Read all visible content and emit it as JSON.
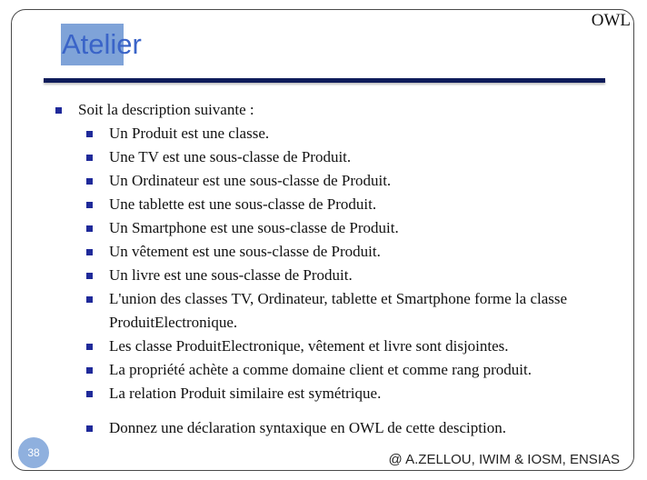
{
  "header": {
    "corner_label": "OWL",
    "title": "Atelier"
  },
  "content": {
    "intro": "Soit la description suivante :",
    "items": [
      "Un Produit est une classe.",
      "Une TV est une sous-classe de Produit.",
      "Un Ordinateur est une sous-classe de Produit.",
      "Une tablette est une sous-classe de Produit.",
      "Un Smartphone est une sous-classe de Produit.",
      "Un vêtement est une sous-classe de Produit.",
      "Un livre est une sous-classe de Produit.",
      "L'union des classes TV, Ordinateur, tablette et Smartphone forme la classe ProduitElectronique.",
      "Les classe ProduitElectronique, vêtement et livre sont disjointes.",
      "La propriété achète a comme domaine client et comme rang produit.",
      "La relation Produit similaire est symétrique."
    ],
    "task": "Donnez une déclaration syntaxique en OWL de cette desciption."
  },
  "footer": {
    "page_number": "38",
    "credit": "@ A.ZELLOU, IWIM & IOSM, ENSIAS"
  },
  "colors": {
    "title": "#3a64c8",
    "title_highlight": "#7fa3d8",
    "rule": "#0f1c5a",
    "bullet": "#1f2a9a",
    "badge": "#8fb0de"
  }
}
